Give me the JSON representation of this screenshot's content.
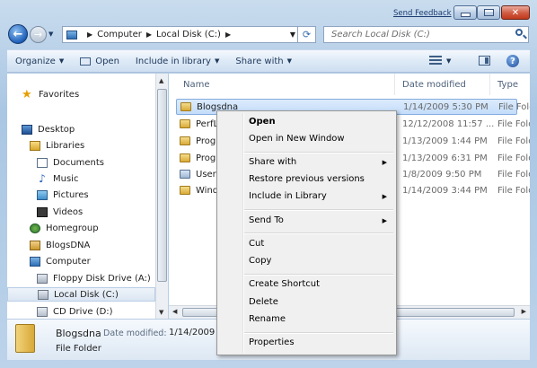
{
  "titlebar": {
    "feedback_link": "Send Feedback"
  },
  "address": {
    "crumbs": [
      "Computer",
      "Local Disk (C:)"
    ]
  },
  "search": {
    "placeholder": "Search Local Disk (C:)"
  },
  "toolbar": {
    "organize": "Organize",
    "open": "Open",
    "include": "Include in library",
    "share": "Share with"
  },
  "nav": {
    "favorites": "Favorites",
    "desktop": "Desktop",
    "libraries": "Libraries",
    "documents": "Documents",
    "music": "Music",
    "pictures": "Pictures",
    "videos": "Videos",
    "homegroup": "Homegroup",
    "user": "BlogsDNA",
    "computer": "Computer",
    "floppy": "Floppy Disk Drive (A:)",
    "localdisk": "Local Disk (C:)",
    "cd": "CD Drive (D:)"
  },
  "columns": {
    "name": "Name",
    "date": "Date modified",
    "type": "Type"
  },
  "files": [
    {
      "name": "Blogsdna",
      "date": "1/14/2009 5:30 PM",
      "type": "File Fold"
    },
    {
      "name": "PerfL",
      "date": "12/12/2008 11:57 ...",
      "type": "File Fold"
    },
    {
      "name": "Prog",
      "date": "1/13/2009 1:44 PM",
      "type": "File Fold"
    },
    {
      "name": "Prog",
      "date": "1/13/2009 6:31 PM",
      "type": "File Fold"
    },
    {
      "name": "Users",
      "date": "1/8/2009 9:50 PM",
      "type": "File Fold"
    },
    {
      "name": "Wind",
      "date": "1/14/2009 3:44 PM",
      "type": "File Fold"
    }
  ],
  "details": {
    "name": "Blogsdna",
    "label": "Date modified:",
    "value": "1/14/2009 5:30 PM",
    "type": "File Folder"
  },
  "context_menu": {
    "open": "Open",
    "open_new_window": "Open in New Window",
    "share_with": "Share with",
    "restore": "Restore previous versions",
    "include": "Include in Library",
    "send_to": "Send To",
    "cut": "Cut",
    "copy": "Copy",
    "create_shortcut": "Create Shortcut",
    "delete": "Delete",
    "rename": "Rename",
    "properties": "Properties"
  }
}
